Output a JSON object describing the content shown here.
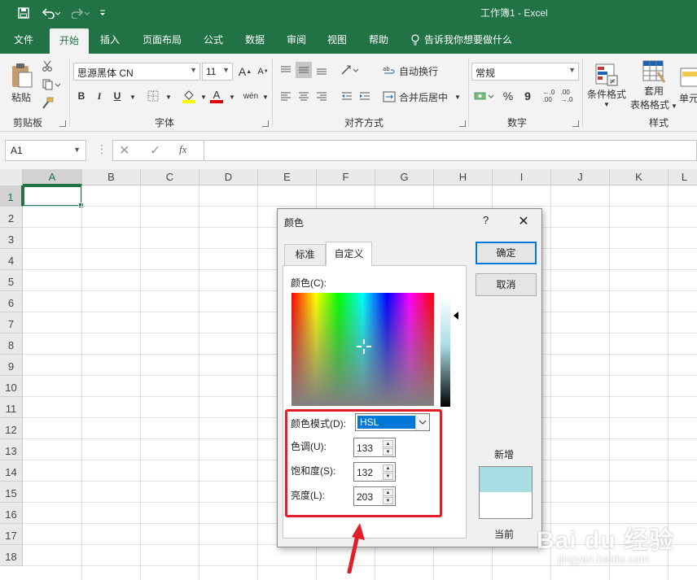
{
  "app": {
    "title": "工作簿1  -  Excel"
  },
  "quick_access": {
    "save_icon": "save-icon",
    "undo_icon": "undo-icon",
    "redo_icon": "redo-icon",
    "customize_icon": "customize-icon"
  },
  "tabs": [
    {
      "label": "文件"
    },
    {
      "label": "开始"
    },
    {
      "label": "插入"
    },
    {
      "label": "页面布局"
    },
    {
      "label": "公式"
    },
    {
      "label": "数据"
    },
    {
      "label": "审阅"
    },
    {
      "label": "视图"
    },
    {
      "label": "帮助"
    },
    {
      "label": "告诉我你想要做什么"
    }
  ],
  "ribbon": {
    "clipboard": {
      "paste_label": "粘贴",
      "group_label": "剪贴板"
    },
    "font": {
      "name": "思源黑体 CN",
      "size": "11",
      "bold": "B",
      "italic": "I",
      "underline": "U",
      "group_label": "字体"
    },
    "alignment": {
      "wrap_label": "自动换行",
      "merge_label": "合并后居中",
      "group_label": "对齐方式"
    },
    "number": {
      "format": "常规",
      "percent": "%",
      "comma": "9",
      "group_label": "数字"
    },
    "styles": {
      "conditional_label": "条件格式",
      "table_label1": "套用",
      "table_label2": "表格格式",
      "cell_label": "单元",
      "group_label": "样式"
    }
  },
  "formula_bar": {
    "name_box": "A1",
    "fx": "fx",
    "formula": ""
  },
  "grid": {
    "columns": [
      "A",
      "B",
      "C",
      "D",
      "E",
      "F",
      "G",
      "H",
      "I",
      "J",
      "K",
      "L"
    ],
    "rows": [
      "1",
      "2",
      "3",
      "4",
      "5",
      "6",
      "7",
      "8",
      "9",
      "10",
      "11",
      "12",
      "13",
      "14",
      "15",
      "16",
      "17",
      "18"
    ],
    "selected_cell": "A1"
  },
  "dialog": {
    "title": "颜色",
    "help": "?",
    "close": "✕",
    "tabs": {
      "standard": "标准",
      "custom": "自定义"
    },
    "colors_label": "颜色(C):",
    "mode_label": "颜色模式(D):",
    "mode_value": "HSL",
    "hue_label": "色调(U):",
    "hue_value": "133",
    "sat_label": "饱和度(S):",
    "sat_value": "132",
    "lum_label": "亮度(L):",
    "lum_value": "203",
    "ok": "确定",
    "cancel": "取消",
    "new_label": "新增",
    "current_label": "当前",
    "new_color": "#a7dde3",
    "current_color": "#ffffff"
  },
  "annotation": {
    "highlight_color": "#e01f28"
  },
  "watermark": {
    "brand": "Bai du 经验",
    "sub": "jingyan.baidu.com"
  }
}
